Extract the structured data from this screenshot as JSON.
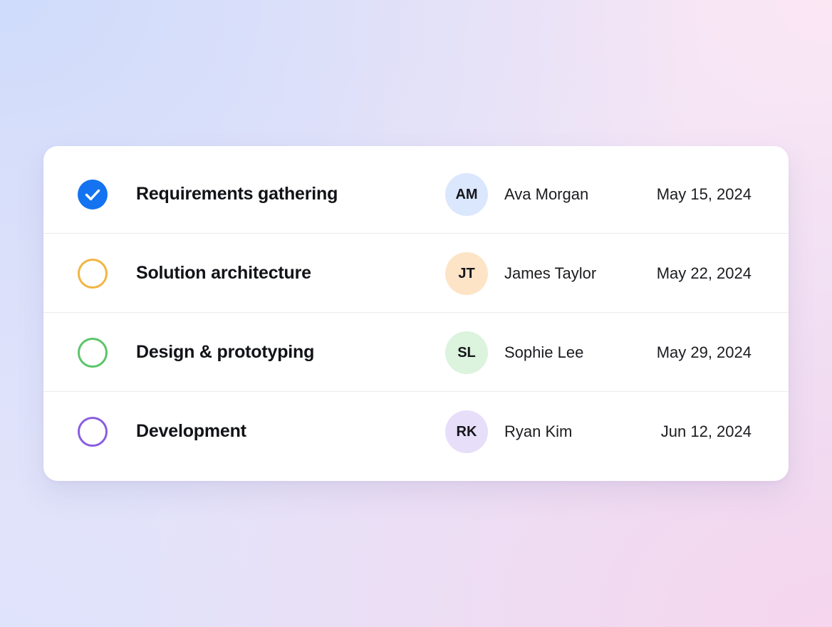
{
  "colors": {
    "accent": "#1473f0",
    "divider": "#ebebef"
  },
  "tasks": [
    {
      "title": "Requirements gathering",
      "status": "completed",
      "status_icon": "check-circle-icon",
      "status_color": "#1473f0",
      "assignee_initials": "AM",
      "assignee_name": "Ava Morgan",
      "avatar_color": "#dbe7fd",
      "due_date": "May 15, 2024"
    },
    {
      "title": "Solution architecture",
      "status": "pending",
      "status_icon": "empty-circle-icon",
      "status_color": "#f2b544",
      "assignee_initials": "JT",
      "assignee_name": "James Taylor",
      "avatar_color": "#fde4c6",
      "due_date": "May 22, 2024"
    },
    {
      "title": "Design & prototyping",
      "status": "pending",
      "status_icon": "empty-circle-icon",
      "status_color": "#5cc56a",
      "assignee_initials": "SL",
      "assignee_name": "Sophie Lee",
      "avatar_color": "#dcf3de",
      "due_date": "May 29, 2024"
    },
    {
      "title": "Development",
      "status": "pending",
      "status_icon": "empty-circle-icon",
      "status_color": "#8a5ee0",
      "assignee_initials": "RK",
      "assignee_name": "Ryan Kim",
      "avatar_color": "#e7defa",
      "due_date": "Jun 12, 2024"
    }
  ]
}
